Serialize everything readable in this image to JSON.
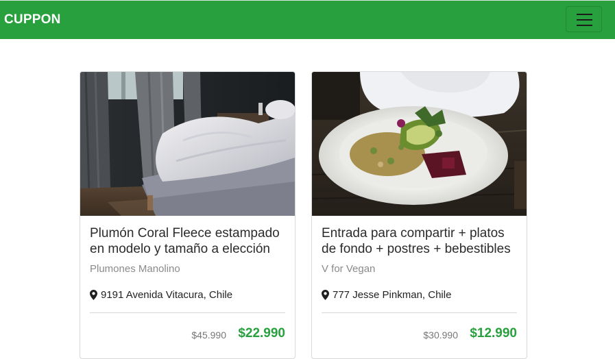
{
  "navbar": {
    "brand": "CUPPON",
    "color": "#28a03d",
    "toggle_icon": "hamburger-menu-icon"
  },
  "deals": [
    {
      "title": "Plumón Coral Fleece estampado en modelo y tamaño a elección",
      "merchant": "Plumones Manolino",
      "location": "9191 Avenida Vitacura, Chile",
      "old_price": "$45.990",
      "new_price": "$22.990",
      "image": "bedroom-bed-photo"
    },
    {
      "title": "Entrada para compartir + platos de fondo + postres + bebestibles",
      "merchant": "V for Vegan",
      "location": "777 Jesse Pinkman, Chile",
      "old_price": "$30.990",
      "new_price": "$12.990",
      "image": "vegan-salad-bowl-photo"
    }
  ],
  "colors": {
    "accent": "#28a03d",
    "price": "#28a03d"
  }
}
